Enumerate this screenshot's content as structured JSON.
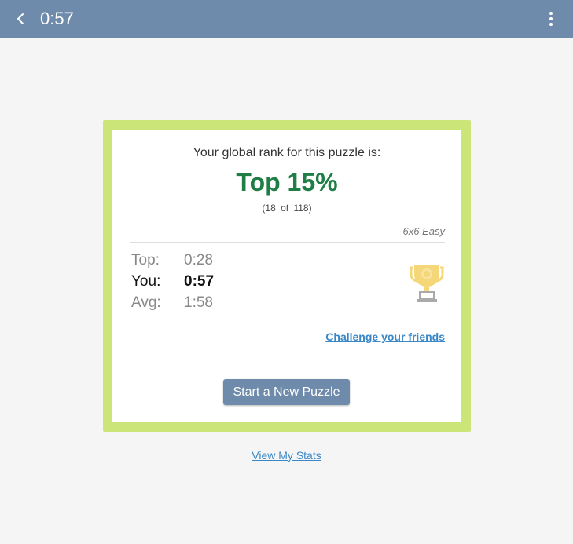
{
  "header": {
    "title": "0:57",
    "back_icon": "chevron-left-icon",
    "menu_icon": "more-vertical-icon",
    "bar_color": "#6f8bab"
  },
  "result": {
    "rank_caption": "Your global rank for this puzzle is:",
    "rank_value": "Top 15%",
    "rank_count": "(18 of 118)",
    "difficulty": "6x6 Easy",
    "rank_color": "#1e7e45",
    "card_border_color": "#cce579"
  },
  "stats": [
    {
      "label": "Top:",
      "value": "0:28"
    },
    {
      "label": "You:",
      "value": "0:57"
    },
    {
      "label": "Avg:",
      "value": "1:58"
    }
  ],
  "trophy_icon": "trophy-icon",
  "links": {
    "challenge": "Challenge your friends",
    "view_stats": "View My Stats",
    "link_color": "#3a87c7"
  },
  "actions": {
    "new_puzzle": "Start a New Puzzle"
  }
}
